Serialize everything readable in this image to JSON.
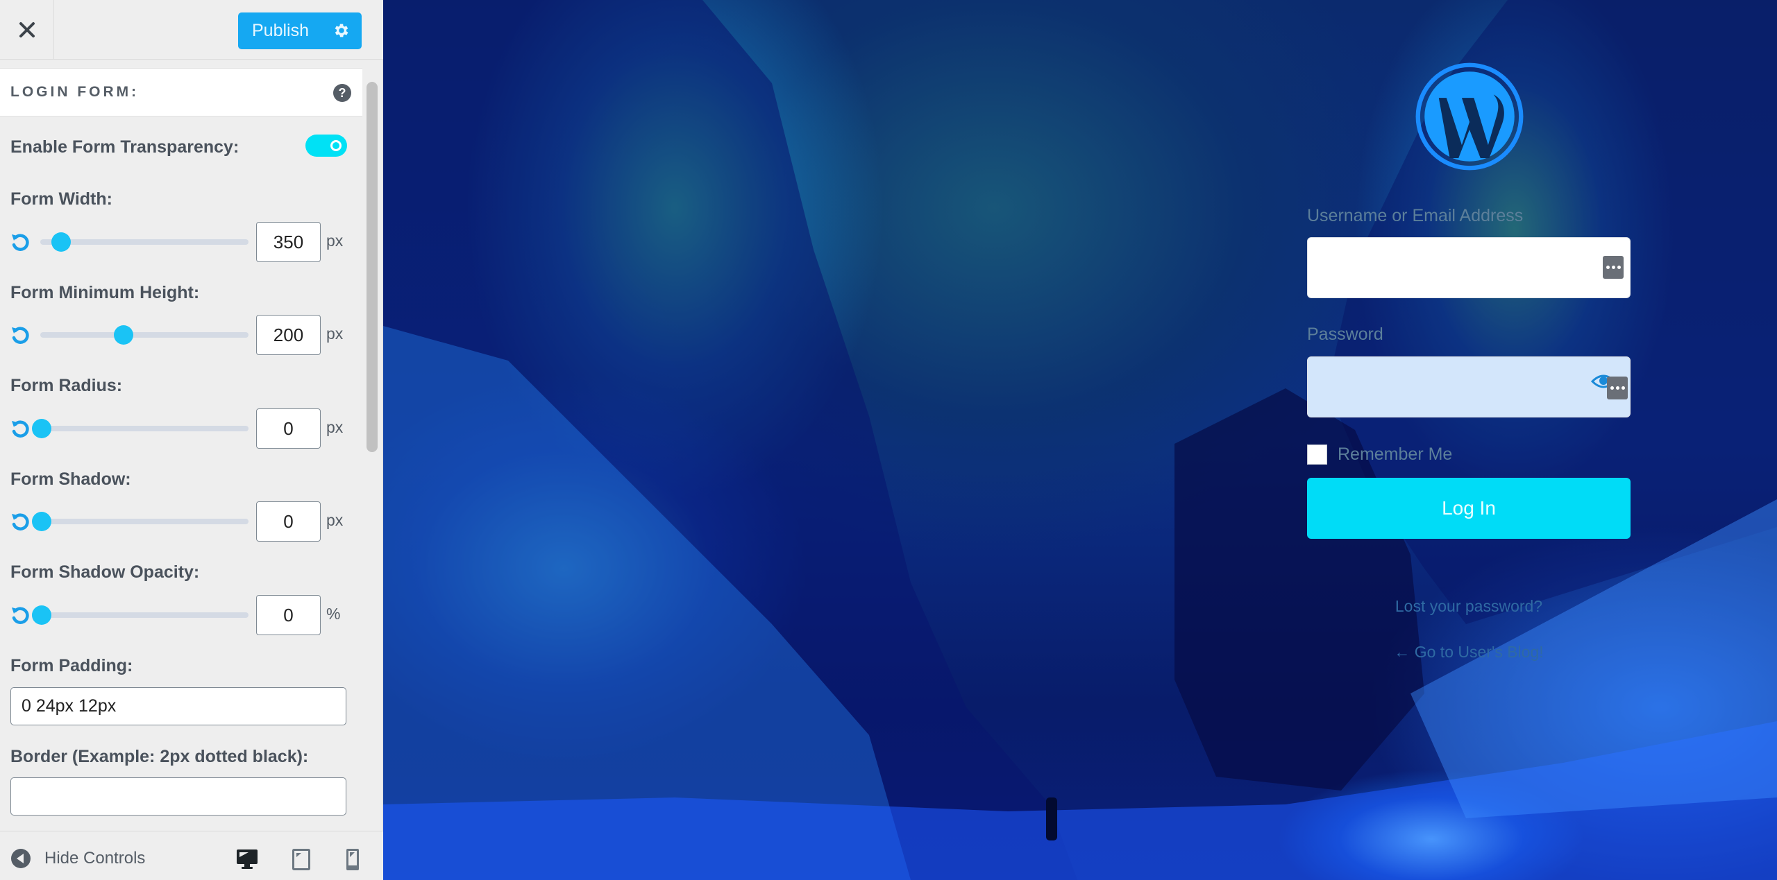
{
  "header": {
    "close_icon": "close-icon",
    "publish_label": "Publish",
    "publish_settings_icon": "gear-icon"
  },
  "section": {
    "title": "LOGIN FORM:",
    "help_icon": "question-mark-icon",
    "help_glyph": "?"
  },
  "controls": {
    "transparency": {
      "label": "Enable Form Transparency:",
      "enabled": true
    },
    "form_width": {
      "label": "Form Width:",
      "value": "350",
      "unit": "px",
      "slider_fraction": 0.1
    },
    "form_min_height": {
      "label": "Form Minimum Height:",
      "value": "200",
      "unit": "px",
      "slider_fraction": 0.4
    },
    "form_radius": {
      "label": "Form Radius:",
      "value": "0",
      "unit": "px",
      "slider_fraction": 0
    },
    "form_shadow": {
      "label": "Form Shadow:",
      "value": "0",
      "unit": "px",
      "slider_fraction": 0
    },
    "form_shadow_opacity": {
      "label": "Form Shadow Opacity:",
      "value": "0",
      "unit": "%",
      "slider_fraction": 0
    },
    "form_padding": {
      "label": "Form Padding:",
      "value": "0 24px 12px"
    },
    "border": {
      "label": "Border (Example: 2px dotted black):",
      "value": ""
    }
  },
  "footer": {
    "hide_controls_label": "Hide Controls",
    "devices": [
      "desktop",
      "tablet",
      "mobile"
    ],
    "active_device": "desktop"
  },
  "login_preview": {
    "logo": "wordpress-logo",
    "username_label": "Username or Email Address",
    "username_value": "",
    "password_label": "Password",
    "password_value": "",
    "remember_label": "Remember Me",
    "remember_checked": false,
    "login_button": "Log In",
    "lost_password_link": "Lost your password?",
    "back_to_blog_link": "← Go to User's Blog!"
  },
  "colors": {
    "accent": "#15a8f2",
    "toggle_on": "#00e1f5",
    "slider_thumb": "#1ac3f5",
    "login_button": "#00dcf7",
    "panel_bg": "#eeeeee"
  }
}
